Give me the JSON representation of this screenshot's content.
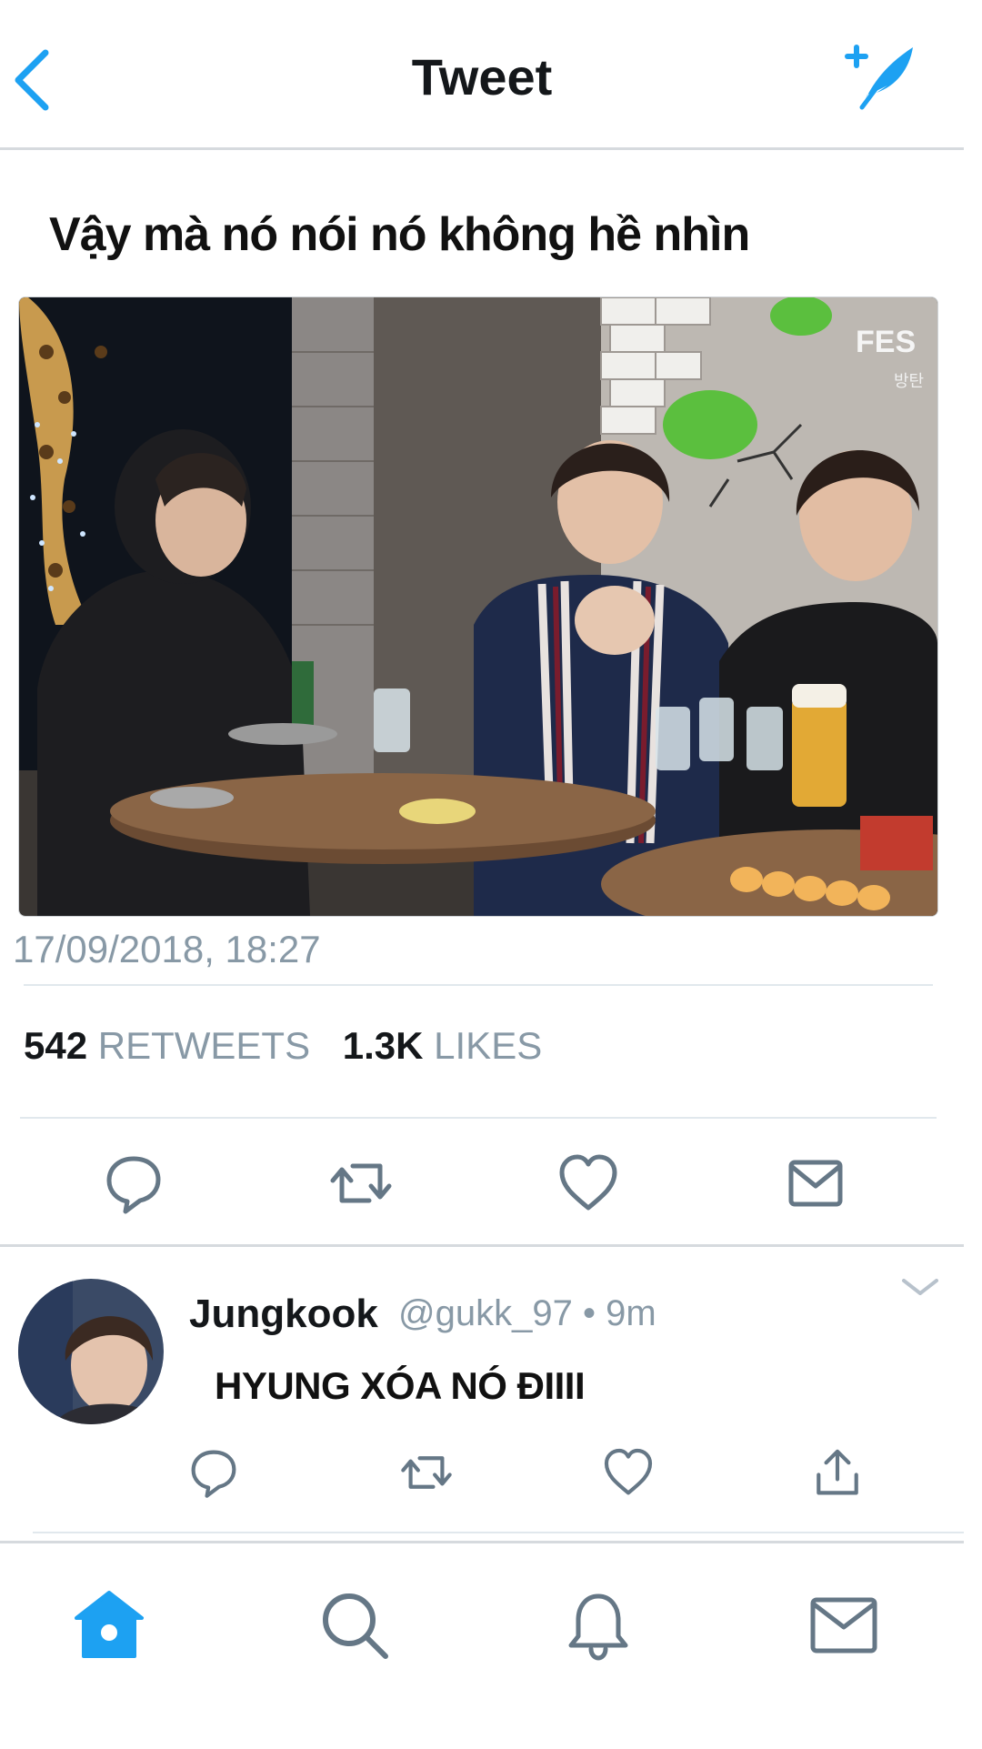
{
  "header": {
    "title": "Tweet",
    "back_icon": "chevron-left-icon",
    "compose_icon": "compose-feather-icon",
    "accent": "#1da1f2"
  },
  "tweet": {
    "text": "Vậy mà nó nói nó không hề nhìn",
    "media_overlay_text": "FES",
    "media_overlay_subtext": "방탄",
    "timestamp": "17/09/2018, 18:27",
    "retweets_count": "542",
    "retweets_label": "RETWEETS",
    "likes_count": "1.3K",
    "likes_label": "LIKES",
    "actions": [
      "reply-icon",
      "retweet-icon",
      "heart-icon",
      "mail-icon"
    ]
  },
  "reply": {
    "name": "Jungkook",
    "meta": "@gukk_97 • 9m",
    "text": "HYUNG XÓA NÓ ĐIIII",
    "actions": [
      "reply-icon",
      "retweet-icon",
      "heart-icon",
      "share-icon"
    ]
  },
  "bottom_nav": {
    "items": [
      "home-icon",
      "search-icon",
      "bell-icon",
      "mail-icon"
    ],
    "active": "home-icon"
  },
  "colors": {
    "accent": "#1da1f2",
    "icon_gray": "#657786",
    "secondary_text": "#8899a6",
    "divider": "#e1e8ed"
  }
}
